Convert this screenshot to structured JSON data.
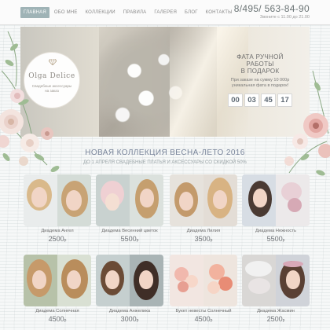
{
  "nav": {
    "items": [
      "Главная",
      "Обо мне",
      "Коллекции",
      "Правила",
      "Галерея",
      "Блог",
      "Контакты"
    ]
  },
  "contact": {
    "phone": "8/495/ 563-84-90",
    "hours": "Звоните с 11.00 до 21.00"
  },
  "logo": {
    "name": "Olga Delice",
    "tagline": "Свадебные аксессуары на заказ"
  },
  "promo": {
    "title_line1": "Фата ручной работы",
    "title_line2": "в подарок",
    "text_line1": "При заказе на сумму 10 000р",
    "text_line2": "уникальная фата в подарок!",
    "timer": [
      "00",
      "03",
      "45",
      "17"
    ]
  },
  "collection": {
    "title": "Новая коллекция весна-лето 2016",
    "subtitle": "До 1 апреля свадебные платья и аксессуары со скидкой 50%"
  },
  "products": [
    {
      "name": "Диадема Ангел",
      "price": "2500",
      "currency": "р"
    },
    {
      "name": "Диадема Весенний цветок",
      "price": "5500",
      "currency": "р"
    },
    {
      "name": "Диадема Лилия",
      "price": "3500",
      "currency": "р"
    },
    {
      "name": "Диадема Нежность",
      "price": "5500",
      "currency": "р"
    },
    {
      "name": "Диадема Солнечная",
      "price": "4500",
      "currency": "р"
    },
    {
      "name": "Диадема Анжелика",
      "price": "3000",
      "currency": "р"
    },
    {
      "name": "Букет невесты Солнечный",
      "price": "4500",
      "currency": "р"
    },
    {
      "name": "Диадема Жасмин",
      "price": "2500",
      "currency": "р"
    }
  ],
  "colors": {
    "accent": "#9fb3b6",
    "title": "#78849a",
    "pink": "#e8b8b0"
  }
}
